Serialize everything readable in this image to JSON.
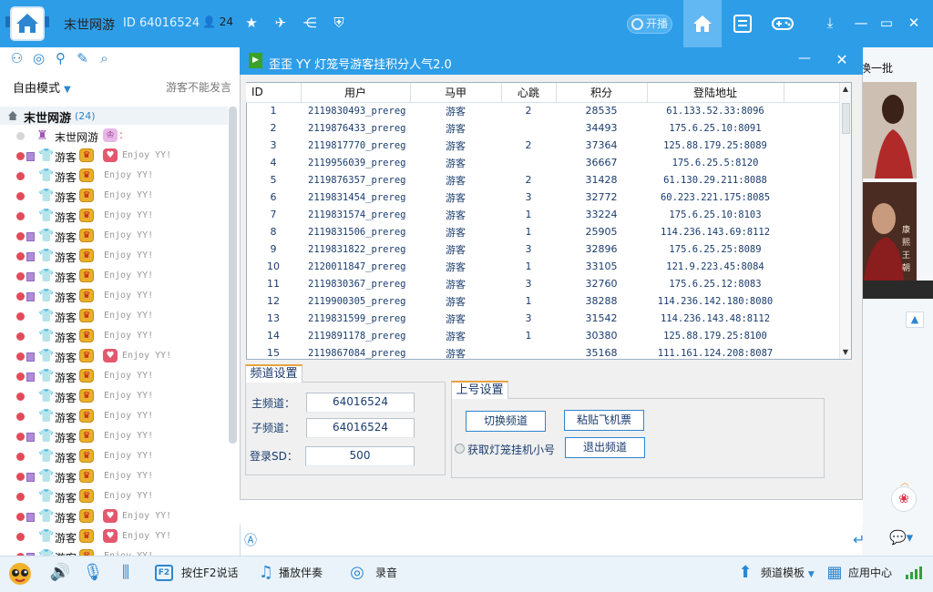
{
  "header": {
    "channel_name": "末世网游",
    "channel_id": "ID 64016524",
    "online_count": "24",
    "broadcast_label": "开播"
  },
  "left": {
    "mode_label": "自由模式",
    "guest_notice": "游客不能发言",
    "tree_name": "末世网游",
    "tree_count": "(24)",
    "members": [
      {
        "name": "末世网游",
        "status": "grey",
        "badge": false,
        "crown": false,
        "heart": true,
        "text": ""
      },
      {
        "name": "游客",
        "status": "red",
        "badge": true,
        "crown": true,
        "heart": true,
        "text": "Enjoy YY!"
      },
      {
        "name": "游客",
        "status": "red",
        "badge": false,
        "crown": true,
        "heart": false,
        "text": "Enjoy YY!"
      },
      {
        "name": "游客",
        "status": "red",
        "badge": false,
        "crown": true,
        "heart": false,
        "text": "Enjoy YY!"
      },
      {
        "name": "游客",
        "status": "red",
        "badge": false,
        "crown": true,
        "heart": false,
        "text": "Enjoy YY!"
      },
      {
        "name": "游客",
        "status": "red",
        "badge": true,
        "crown": true,
        "heart": false,
        "text": "Enjoy YY!"
      },
      {
        "name": "游客",
        "status": "red",
        "badge": true,
        "crown": true,
        "heart": false,
        "text": "Enjoy YY!"
      },
      {
        "name": "游客",
        "status": "red",
        "badge": true,
        "crown": true,
        "heart": false,
        "text": "Enjoy YY!"
      },
      {
        "name": "游客",
        "status": "red",
        "badge": true,
        "crown": true,
        "heart": false,
        "text": "Enjoy YY!"
      },
      {
        "name": "游客",
        "status": "red",
        "badge": false,
        "crown": true,
        "heart": false,
        "text": "Enjoy YY!"
      },
      {
        "name": "游客",
        "status": "red",
        "badge": false,
        "crown": true,
        "heart": false,
        "text": "Enjoy YY!"
      },
      {
        "name": "游客",
        "status": "red",
        "badge": true,
        "crown": true,
        "heart": true,
        "text": "Enjoy YY!"
      },
      {
        "name": "游客",
        "status": "red",
        "badge": true,
        "crown": true,
        "heart": false,
        "text": "Enjoy YY!"
      },
      {
        "name": "游客",
        "status": "red",
        "badge": false,
        "crown": true,
        "heart": false,
        "text": "Enjoy YY!"
      },
      {
        "name": "游客",
        "status": "red",
        "badge": false,
        "crown": true,
        "heart": false,
        "text": "Enjoy YY!"
      },
      {
        "name": "游客",
        "status": "red",
        "badge": true,
        "crown": true,
        "heart": false,
        "text": "Enjoy YY!"
      },
      {
        "name": "游客",
        "status": "red",
        "badge": false,
        "crown": true,
        "heart": false,
        "text": "Enjoy YY!"
      },
      {
        "name": "游客",
        "status": "red",
        "badge": true,
        "crown": true,
        "heart": false,
        "text": "Enjoy YY!"
      },
      {
        "name": "游客",
        "status": "red",
        "badge": false,
        "crown": true,
        "heart": false,
        "text": "Enjoy YY!"
      },
      {
        "name": "游客",
        "status": "red",
        "badge": true,
        "crown": true,
        "heart": true,
        "text": "Enjoy YY!"
      },
      {
        "name": "游客",
        "status": "red",
        "badge": false,
        "crown": true,
        "heart": true,
        "text": "Enjoy YY!"
      },
      {
        "name": "游客",
        "status": "red",
        "badge": true,
        "crown": true,
        "heart": false,
        "text": "Enjoy YY!"
      },
      {
        "name": "游客",
        "status": "red",
        "badge": true,
        "crown": true,
        "heart": true,
        "text": "Enjoy YY!"
      }
    ]
  },
  "dialog": {
    "title": "歪歪 YY 灯笼号游客挂积分人气2.0",
    "columns": [
      "ID",
      "用户",
      "马甲",
      "心跳",
      "积分",
      "登陆地址"
    ],
    "rows": [
      [
        "1",
        "2119830493_prereg",
        "游客",
        "2",
        "28535",
        "61.133.52.33:8096"
      ],
      [
        "2",
        "2119876433_prereg",
        "游客",
        "",
        "34493",
        "175.6.25.10:8091"
      ],
      [
        "3",
        "2119817770_prereg",
        "游客",
        "2",
        "37364",
        "125.88.179.25:8089"
      ],
      [
        "4",
        "2119956039_prereg",
        "游客",
        "",
        "36667",
        "175.6.25.5:8120"
      ],
      [
        "5",
        "2119876357_prereg",
        "游客",
        "2",
        "31428",
        "61.130.29.211:8088"
      ],
      [
        "6",
        "2119831454_prereg",
        "游客",
        "3",
        "32772",
        "60.223.221.175:8085"
      ],
      [
        "7",
        "2119831574_prereg",
        "游客",
        "1",
        "33224",
        "175.6.25.10:8103"
      ],
      [
        "8",
        "2119831506_prereg",
        "游客",
        "1",
        "25905",
        "114.236.143.69:8112"
      ],
      [
        "9",
        "2119831822_prereg",
        "游客",
        "3",
        "32896",
        "175.6.25.25:8089"
      ],
      [
        "10",
        "2120011847_prereg",
        "游客",
        "1",
        "33105",
        "121.9.223.45:8084"
      ],
      [
        "11",
        "2119830367_prereg",
        "游客",
        "3",
        "32760",
        "175.6.25.12:8083"
      ],
      [
        "12",
        "2119900305_prereg",
        "游客",
        "1",
        "38288",
        "114.236.142.180:8080"
      ],
      [
        "13",
        "2119831599_prereg",
        "游客",
        "3",
        "31542",
        "114.236.143.48:8112"
      ],
      [
        "14",
        "2119891178_prereg",
        "游客",
        "1",
        "30380",
        "125.88.179.25:8100"
      ],
      [
        "15",
        "2119867084_prereg",
        "游客",
        "",
        "35168",
        "111.161.124.208:8087"
      ]
    ],
    "channel_tab": "频道设置",
    "main_channel_label": "主频道：",
    "main_channel_value": "64016524",
    "sub_channel_label": "子频道：",
    "sub_channel_value": "64016524",
    "login_sd_label": "登录SD：",
    "login_sd_value": "500",
    "login_tab": "上号设置",
    "switch_channel_btn": "切换频道",
    "paste_ticket_btn": "粘贴飞机票",
    "get_account_label": "获取灯笼挂机小号",
    "exit_channel_btn": "退出频道"
  },
  "right": {
    "swap_label": "换一批",
    "side_text": "康熙王朝"
  },
  "toolbar": {
    "f2_key": "F2",
    "hold_f2_label": "按住F2说话",
    "play_accompaniment_label": "播放伴奏",
    "record_label": "录音",
    "template_label": "频道模板",
    "app_center_label": "应用中心"
  }
}
